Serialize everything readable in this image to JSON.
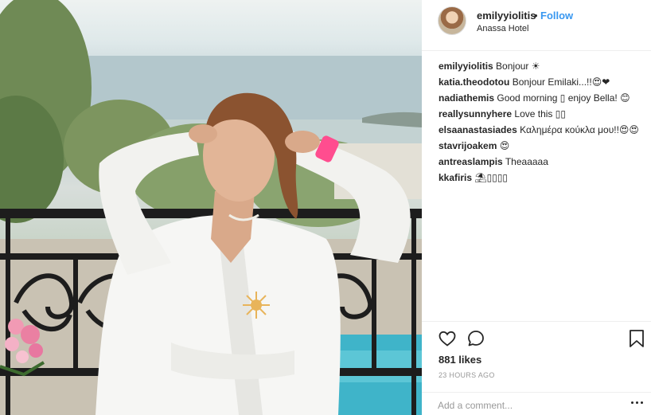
{
  "post": {
    "username": "emilyyiolitis",
    "separator": "•",
    "follow_label": "Follow",
    "location": "Anassa Hotel"
  },
  "comments": [
    {
      "user": "emilyyiolitis",
      "text": "Bonjour ☀"
    },
    {
      "user": "katia.theodotou",
      "text": "Bonjour Emilaki...!!😍❤"
    },
    {
      "user": "nadiathemis",
      "text": "Good morning ▯ enjoy Bella! 😊"
    },
    {
      "user": "reallysunnyhere",
      "text": "Love this ▯▯"
    },
    {
      "user": "elsaanastasiades",
      "text": "Καλημέρα κούκλα μου!!😍😍"
    },
    {
      "user": "stavrijoakem",
      "text": "😍"
    },
    {
      "user": "antreaslampis",
      "text": "Theaaaaa"
    },
    {
      "user": "kkafiris",
      "text": "⛱▯▯▯▯"
    }
  ],
  "actions": {
    "like_icon": "heart-outline-icon",
    "comment_icon": "comment-bubble-icon",
    "save_icon": "bookmark-icon",
    "likes_text": "881 likes",
    "timestamp": "23 HOURS AGO",
    "comment_placeholder": "Add a comment...",
    "more_icon": "more-options-icon"
  },
  "colors": {
    "link_blue": "#3897f0",
    "text": "#262626",
    "muted": "#999999",
    "divider": "#efefef"
  }
}
